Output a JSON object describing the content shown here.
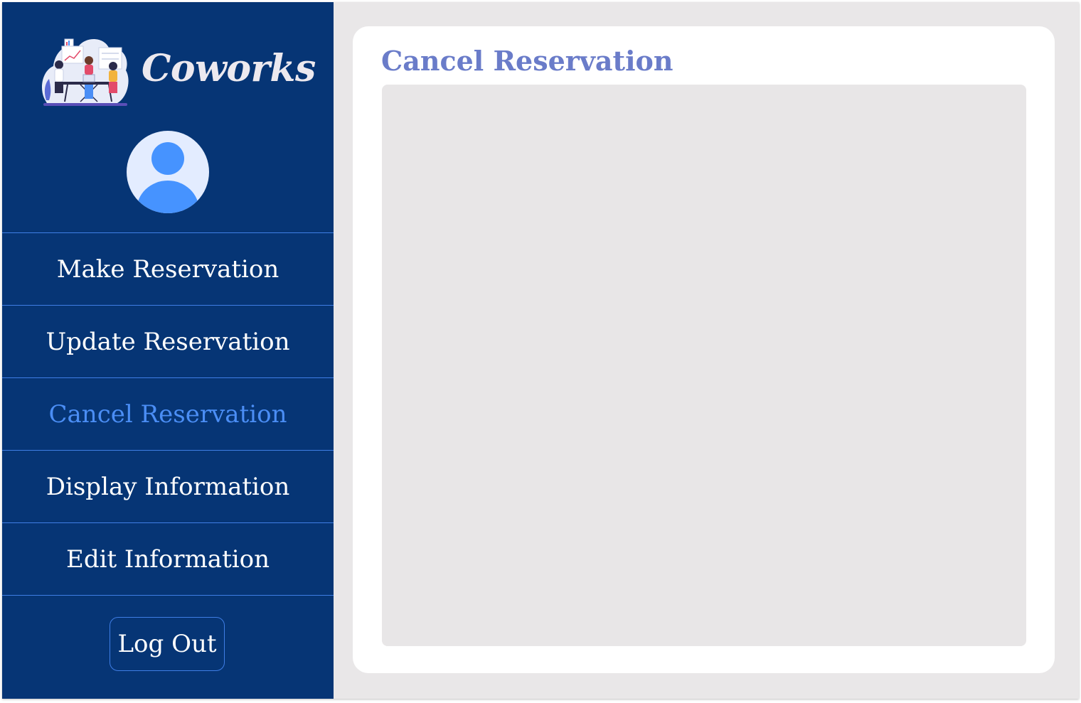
{
  "app": {
    "name": "Coworks",
    "brand_colors": {
      "sidebar": "#063575",
      "accent": "#4b8ef5",
      "title": "#6a7cc9"
    }
  },
  "sidebar": {
    "logo_icon": "coworking-team-illustration",
    "avatar_icon": "user-avatar-icon",
    "items": [
      {
        "label": "Make Reservation",
        "active": false
      },
      {
        "label": "Update Reservation",
        "active": false
      },
      {
        "label": "Cancel Reservation",
        "active": true
      },
      {
        "label": "Display Information",
        "active": false
      },
      {
        "label": "Edit Information",
        "active": false
      }
    ],
    "logout_label": "Log Out"
  },
  "main": {
    "title": "Cancel Reservation"
  }
}
